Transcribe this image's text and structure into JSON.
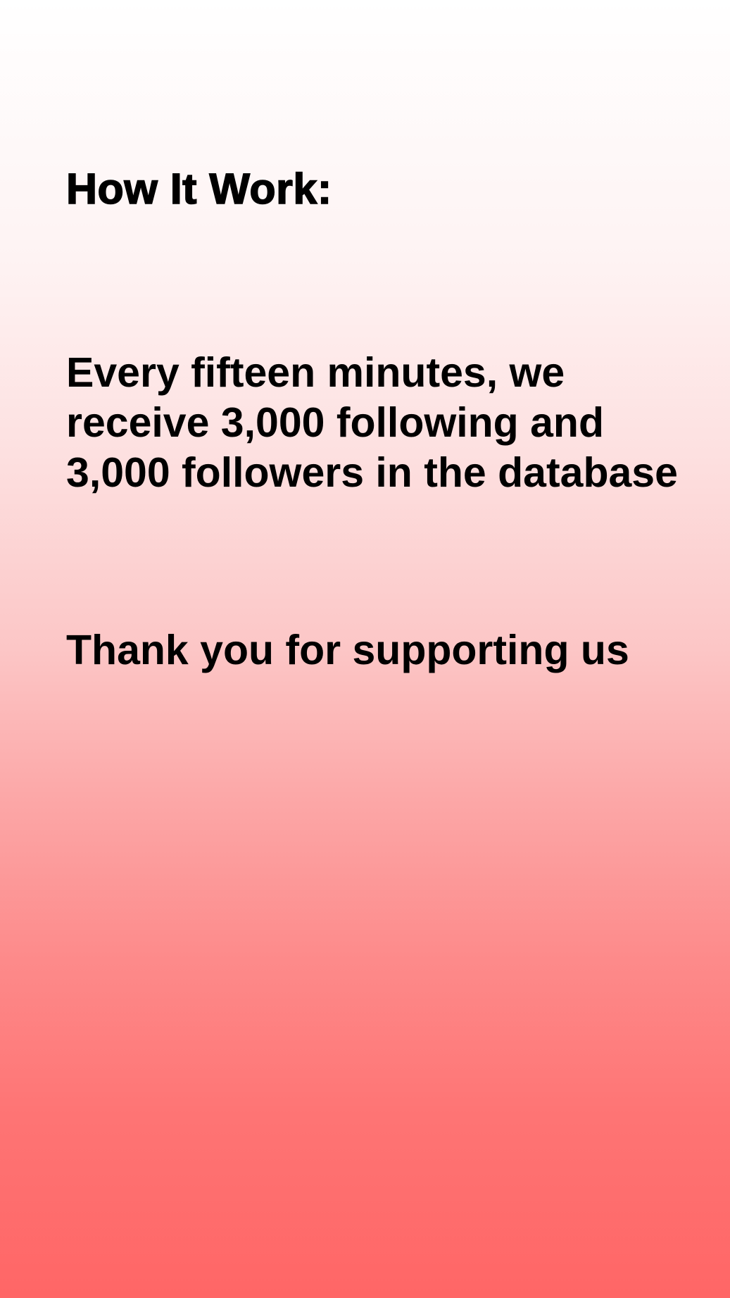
{
  "content": {
    "heading": "How It Work:",
    "description": "Every fifteen minutes, we receive 3,000 following and 3,000 followers in the database",
    "thanks": "Thank you for supporting us"
  },
  "colors": {
    "gradient_top": "#ffffff",
    "gradient_bottom": "#ff6666",
    "text": "#000000"
  }
}
